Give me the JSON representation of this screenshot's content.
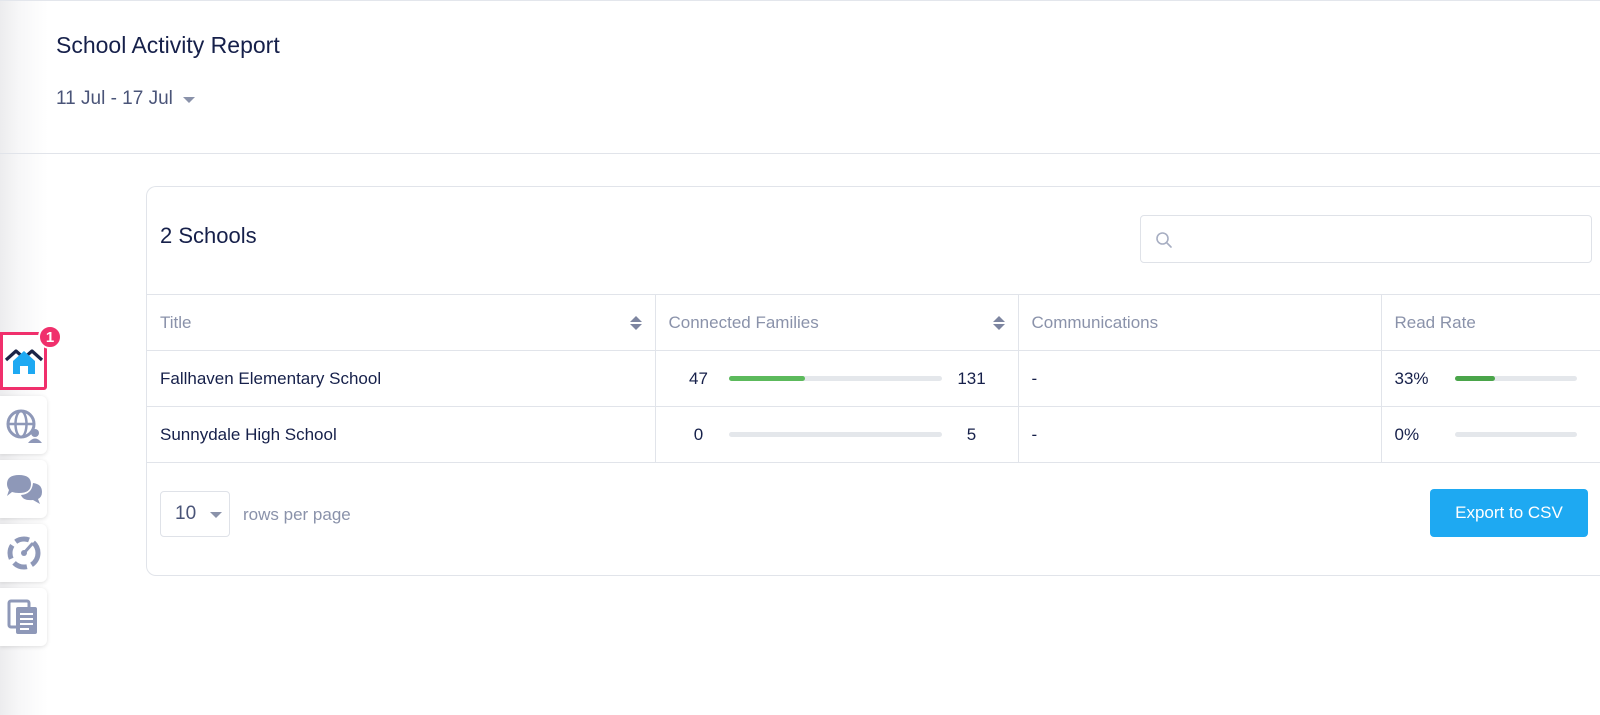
{
  "header": {
    "title": "School Activity Report",
    "date_range": "11 Jul - 17 Jul"
  },
  "card": {
    "title": "2 Schools",
    "search_placeholder": ""
  },
  "table": {
    "columns": [
      "Title",
      "Connected Families",
      "Communications",
      "Read Rate"
    ],
    "rows": [
      {
        "title": "Fallhaven Elementary School",
        "families_connected": "47",
        "families_total": "131",
        "families_fraction": 0.36,
        "communications": "-",
        "read_rate": "33%",
        "read_rate_fraction": 0.33
      },
      {
        "title": "Sunnydale High School",
        "families_connected": "0",
        "families_total": "5",
        "families_fraction": 0,
        "communications": "-",
        "read_rate": "0%",
        "read_rate_fraction": 0
      }
    ]
  },
  "pagination": {
    "rows_per_page": "10",
    "rows_label": "rows per page"
  },
  "actions": {
    "export_label": "Export to CSV"
  },
  "sidebar": {
    "items": [
      {
        "icon": "home-icon",
        "active": true,
        "badge": "1"
      },
      {
        "icon": "globe-user-icon",
        "active": false
      },
      {
        "icon": "chat-bubbles-icon",
        "active": false
      },
      {
        "icon": "gauge-icon",
        "active": false
      },
      {
        "icon": "documents-icon",
        "active": false
      }
    ]
  },
  "colors": {
    "accent": "#1ea9f2",
    "badge": "#f0306c",
    "progress": "#5cba5c",
    "title_text": "#16204a"
  }
}
